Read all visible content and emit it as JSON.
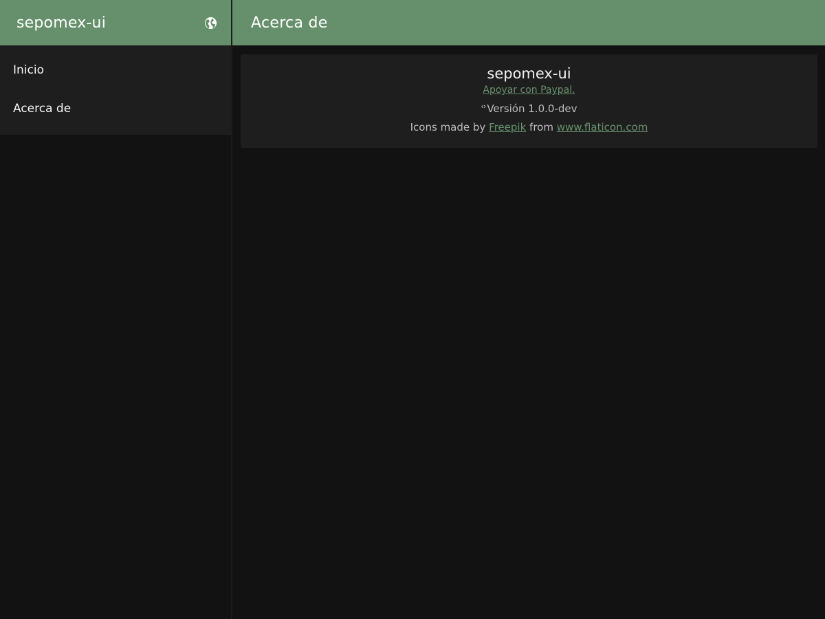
{
  "sidebar": {
    "title": "sepomex-ui",
    "language_icon": "globe-icon",
    "items": [
      {
        "label": "Inicio"
      },
      {
        "label": "Acerca de"
      }
    ]
  },
  "topbar": {
    "title": "Acerca de"
  },
  "about": {
    "app_name": "sepomex-ui",
    "support_link": "Apoyar con Paypal.",
    "version_icon": "code-icon",
    "version_text": "Versión 1.0.0-dev",
    "credits": {
      "prefix": "Icons made by ",
      "author_link": "Freepik",
      "middle": " from ",
      "site_link": "www.flaticon.com"
    }
  },
  "colors": {
    "accent": "#66906b",
    "background": "#121212",
    "surface": "#1e1e1e"
  }
}
